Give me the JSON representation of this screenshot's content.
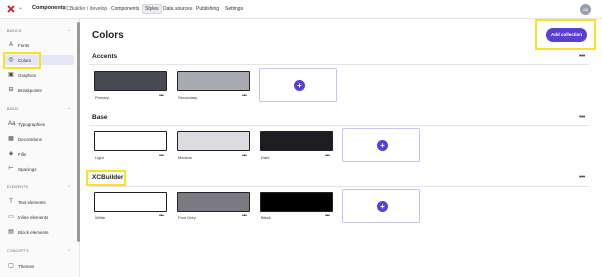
{
  "topbar": {
    "product": "Components",
    "project": "XCBuilder / develop",
    "nav": [
      "Components",
      "Styles",
      "Data sources",
      "Publishing",
      "Settings"
    ],
    "active_nav": "Styles",
    "avatar_initials": "AB"
  },
  "sidebar": {
    "sections": [
      {
        "title": "BASICS",
        "items": [
          {
            "label": "Fonts",
            "icon": "font-icon"
          },
          {
            "label": "Colors",
            "icon": "palette-icon",
            "selected": true
          },
          {
            "label": "Graphics",
            "icon": "image-icon"
          },
          {
            "label": "Breakpoints",
            "icon": "breakpoints-icon"
          }
        ]
      },
      {
        "title": "BASIC",
        "items": [
          {
            "label": "Typographies",
            "icon": "typography-icon"
          },
          {
            "label": "Decorations",
            "icon": "decorations-icon"
          },
          {
            "label": "Fills",
            "icon": "fill-icon"
          },
          {
            "label": "Spacings",
            "icon": "spacing-icon"
          }
        ]
      },
      {
        "title": "ELEMENTS",
        "items": [
          {
            "label": "Text elements",
            "icon": "text-element-icon"
          },
          {
            "label": "Inline elements",
            "icon": "inline-element-icon"
          },
          {
            "label": "Block elements",
            "icon": "block-element-icon"
          }
        ]
      },
      {
        "title": "CONCEPTS",
        "items": [
          {
            "label": "Themes",
            "icon": "themes-icon"
          }
        ]
      }
    ]
  },
  "main": {
    "title": "Colors",
    "add_collection": "Add collection",
    "more_glyph": "•••",
    "groups": [
      {
        "name": "Accents",
        "swatches": [
          {
            "label": "Primary",
            "color": "#4a4a52"
          },
          {
            "label": "Secondary",
            "color": "#a9a9b0"
          }
        ]
      },
      {
        "name": "Base",
        "swatches": [
          {
            "label": "Light",
            "color": "#ffffff"
          },
          {
            "label": "Medium",
            "color": "#dcdce0"
          },
          {
            "label": "Dark",
            "color": "#1e1e22"
          }
        ]
      },
      {
        "name": "XCBuilder",
        "swatches": [
          {
            "label": "White",
            "color": "#ffffff"
          },
          {
            "label": "Font Grey",
            "color": "#7a7a80"
          },
          {
            "label": "Black",
            "color": "#000000"
          }
        ]
      }
    ]
  },
  "colors": {
    "accent": "#5a3fd1",
    "highlight": "#f5e327"
  }
}
